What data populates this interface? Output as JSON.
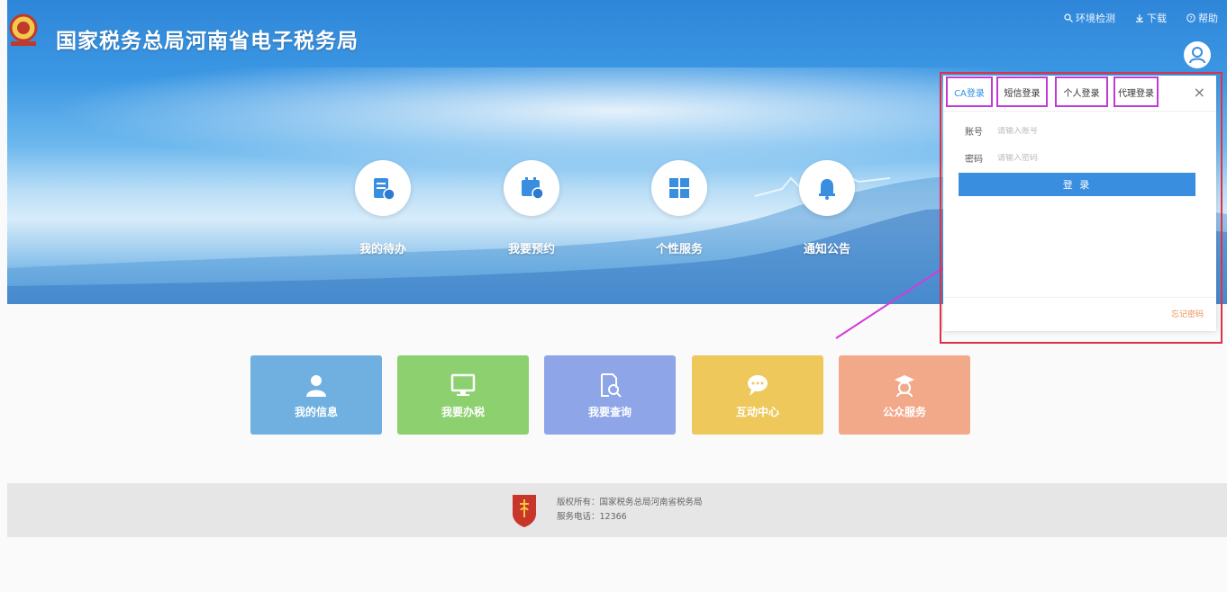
{
  "header": {
    "site_title": "国家税务总局河南省电子税务局",
    "nav": [
      {
        "label": "环境检测",
        "icon": "search-icon"
      },
      {
        "label": "下载",
        "icon": "download-icon"
      },
      {
        "label": "帮助",
        "icon": "help-icon"
      }
    ]
  },
  "quick_links": [
    {
      "label": "我的待办",
      "icon": "todo-document-icon"
    },
    {
      "label": "我要预约",
      "icon": "calendar-clock-icon"
    },
    {
      "label": "个性服务",
      "icon": "grid-apps-icon"
    },
    {
      "label": "通知公告",
      "icon": "bell-icon"
    }
  ],
  "tiles": [
    {
      "label": "我的信息",
      "icon": "person-icon",
      "color": "#6fb0e0"
    },
    {
      "label": "我要办税",
      "icon": "monitor-icon",
      "color": "#8cd070"
    },
    {
      "label": "我要查询",
      "icon": "search-doc-icon",
      "color": "#8ea6e8"
    },
    {
      "label": "互动中心",
      "icon": "chat-icon",
      "color": "#eec85a"
    },
    {
      "label": "公众服务",
      "icon": "graduate-icon",
      "color": "#f2a98a"
    }
  ],
  "login_panel": {
    "tabs": [
      "CA登录",
      "短信登录",
      "个人登录",
      "代理登录"
    ],
    "active_tab": "CA登录",
    "account_label": "账号",
    "account_placeholder": "请输入账号",
    "password_label": "密码",
    "password_placeholder": "请输入密码",
    "login_button": "登 录",
    "forgot_password": "忘记密码",
    "close_symbol": "×"
  },
  "footer": {
    "copyright": "版权所有：国家税务总局河南省税务局",
    "service_phone": "服务电话：12366"
  },
  "colors": {
    "primary_blue": "#3a8ee0",
    "tab_highlight": "#c03bd6",
    "panel_highlight": "#e0314b",
    "annotation_arrow": "#d43bd8"
  }
}
